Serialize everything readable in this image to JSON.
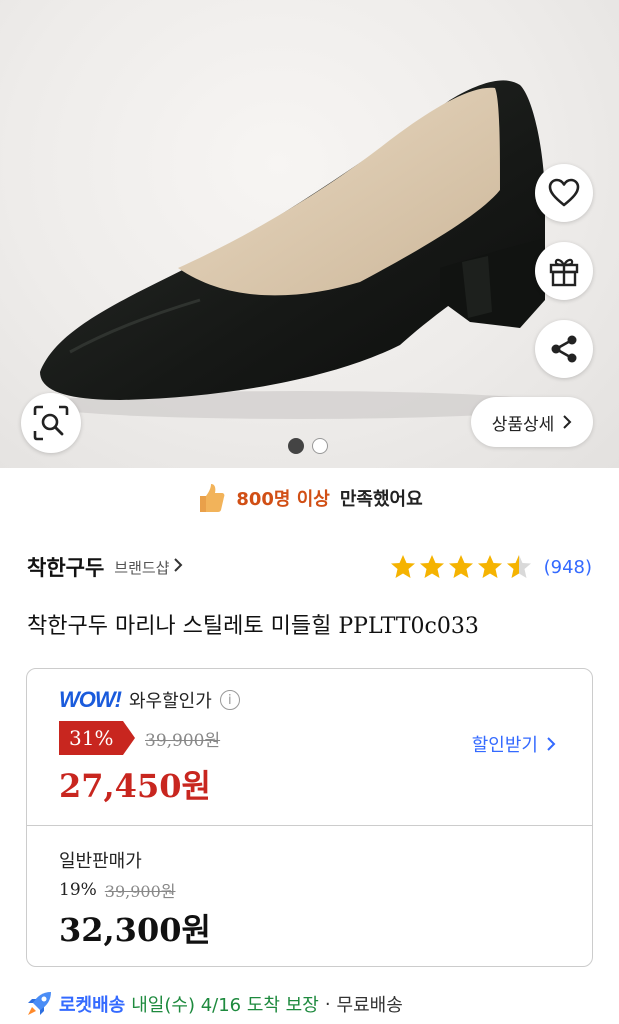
{
  "hero": {
    "detail_label": "상품상세",
    "image_count": 2,
    "active_image": 1
  },
  "satisfaction": {
    "highlight": "800명 이상",
    "rest": "만족했어요"
  },
  "brand": {
    "name": "착한구두",
    "shop_label": "브랜드샵"
  },
  "rating": {
    "stars": 4.5,
    "count": "(948)"
  },
  "product": {
    "title": "착한구두 마리나 스틸레토 미들힐 PPLTT0c033"
  },
  "wow_price": {
    "logo": "WOW!",
    "label": "와우할인가",
    "discount": "31%",
    "original": "39,900원",
    "sale": "27,450원",
    "coupon_label": "할인받기"
  },
  "normal_price": {
    "label": "일반판매가",
    "discount": "19%",
    "original": "39,900원",
    "price": "32,300원"
  },
  "delivery": {
    "rocket_label": "로켓배송",
    "arrival": "내일(수) 4/16 도착 보장",
    "separator": "·",
    "shipping": "무료배송"
  },
  "colors": {
    "accent_blue": "#346aff",
    "sale_red": "#c8261f",
    "star": "#f5b301",
    "arrival_green": "#1e8a3e"
  },
  "icons": [
    "heart-icon",
    "gift-icon",
    "share-icon",
    "lens-search-icon",
    "chevron-right-icon",
    "thumbs-up-icon",
    "info-icon",
    "rocket-icon"
  ]
}
